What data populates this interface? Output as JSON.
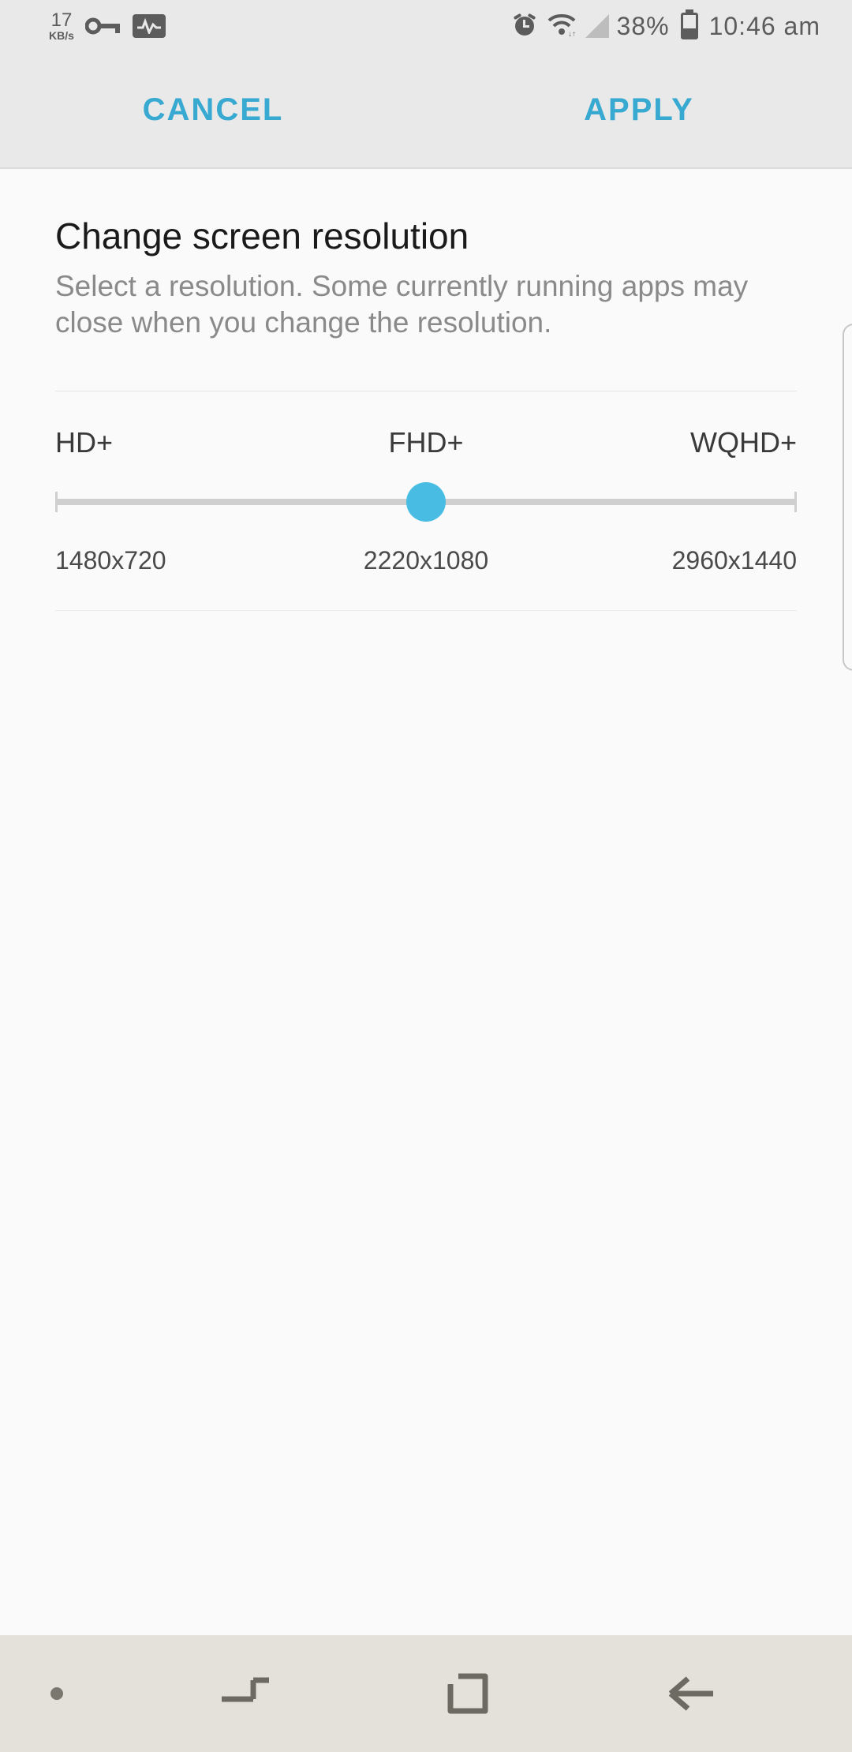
{
  "status": {
    "netspeed_value": "17",
    "netspeed_unit": "KB/s",
    "battery_pct": "38%",
    "time": "10:46 am"
  },
  "actions": {
    "cancel": "CANCEL",
    "apply": "APPLY"
  },
  "page": {
    "title": "Change screen resolution",
    "description": "Select a resolution. Some currently running apps may close when you change the resolution."
  },
  "slider": {
    "selected_index": 1,
    "options": [
      {
        "label": "HD+",
        "value": "1480x720"
      },
      {
        "label": "FHD+",
        "value": "2220x1080"
      },
      {
        "label": "WQHD+",
        "value": "2960x1440"
      }
    ]
  },
  "colors": {
    "accent": "#38a9d1",
    "thumb": "#48bce2"
  }
}
